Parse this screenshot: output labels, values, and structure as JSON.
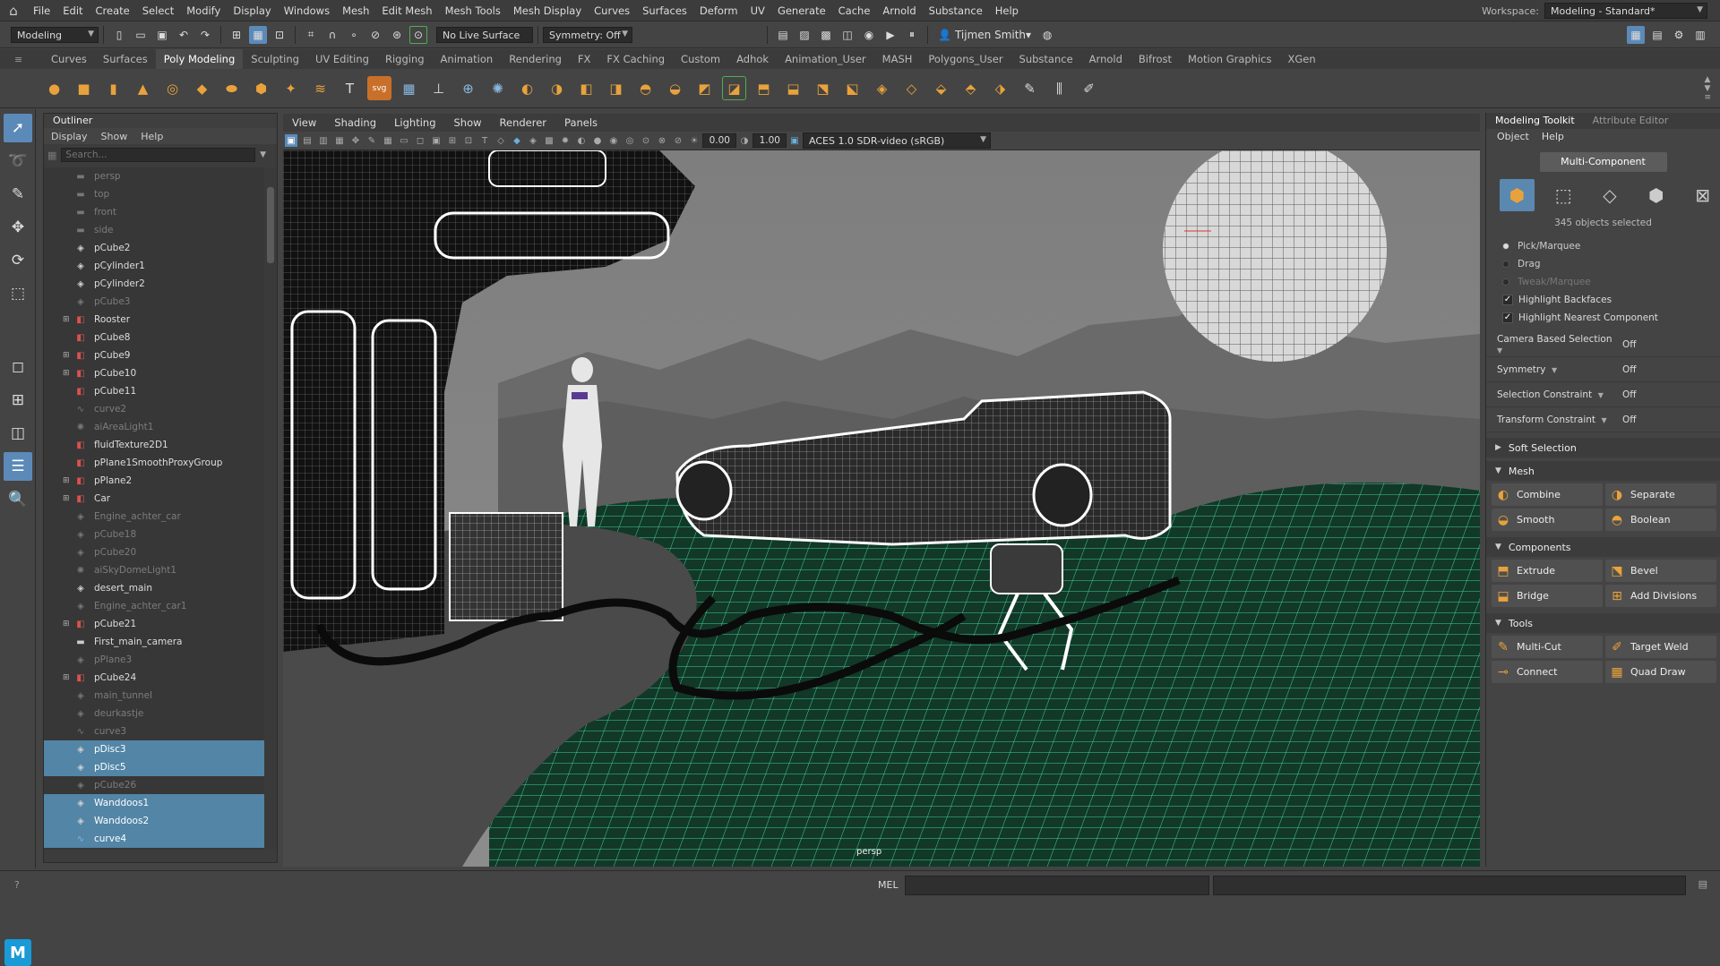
{
  "menubar": {
    "items": [
      "File",
      "Edit",
      "Create",
      "Select",
      "Modify",
      "Display",
      "Windows",
      "Mesh",
      "Edit Mesh",
      "Mesh Tools",
      "Mesh Display",
      "Curves",
      "Surfaces",
      "Deform",
      "UV",
      "Generate",
      "Cache",
      "Arnold",
      "Substance",
      "Help"
    ],
    "workspace_label": "Workspace:",
    "workspace_value": "Modeling - Standard*"
  },
  "statusline": {
    "mode": "Modeling",
    "live_surface": "No Live Surface",
    "symmetry": "Symmetry: Off",
    "user": "Tijmen Smith"
  },
  "shelf": {
    "tabs": [
      "Curves",
      "Surfaces",
      "Poly Modeling",
      "Sculpting",
      "UV Editing",
      "Rigging",
      "Animation",
      "Rendering",
      "FX",
      "FX Caching",
      "Custom",
      "Adhok",
      "Animation_User",
      "MASH",
      "Polygons_User",
      "Substance",
      "Arnold",
      "Bifrost",
      "Motion Graphics",
      "XGen"
    ],
    "active_tab": "Poly Modeling"
  },
  "outliner": {
    "title": "Outliner",
    "menu": [
      "Display",
      "Show",
      "Help"
    ],
    "search_placeholder": "Search...",
    "items": [
      {
        "label": "persp",
        "icon": "camera-icon",
        "dim": true,
        "expand": false,
        "sel": false
      },
      {
        "label": "top",
        "icon": "camera-icon",
        "dim": true,
        "expand": false,
        "sel": false
      },
      {
        "label": "front",
        "icon": "camera-icon",
        "dim": true,
        "expand": false,
        "sel": false
      },
      {
        "label": "side",
        "icon": "camera-icon",
        "dim": true,
        "expand": false,
        "sel": false
      },
      {
        "label": "pCube2",
        "icon": "mesh-icon",
        "dim": false,
        "expand": false,
        "sel": false
      },
      {
        "label": "pCylinder1",
        "icon": "mesh-icon",
        "dim": false,
        "expand": false,
        "sel": false
      },
      {
        "label": "pCylinder2",
        "icon": "mesh-icon",
        "dim": false,
        "expand": false,
        "sel": false
      },
      {
        "label": "pCube3",
        "icon": "mesh-icon",
        "dim": true,
        "expand": false,
        "sel": false
      },
      {
        "label": "Rooster",
        "icon": "group-icon",
        "dim": false,
        "expand": true,
        "sel": false
      },
      {
        "label": "pCube8",
        "icon": "group-icon",
        "dim": false,
        "expand": false,
        "sel": false
      },
      {
        "label": "pCube9",
        "icon": "group-icon",
        "dim": false,
        "expand": true,
        "sel": false
      },
      {
        "label": "pCube10",
        "icon": "group-icon",
        "dim": false,
        "expand": true,
        "sel": false
      },
      {
        "label": "pCube11",
        "icon": "group-icon",
        "dim": false,
        "expand": false,
        "sel": false
      },
      {
        "label": "curve2",
        "icon": "curve-icon",
        "dim": true,
        "expand": false,
        "sel": false
      },
      {
        "label": "aiAreaLight1",
        "icon": "light-icon",
        "dim": true,
        "expand": false,
        "sel": false
      },
      {
        "label": "fluidTexture2D1",
        "icon": "group-icon",
        "dim": false,
        "expand": false,
        "sel": false
      },
      {
        "label": "pPlane1SmoothProxyGroup",
        "icon": "group-icon",
        "dim": false,
        "expand": false,
        "sel": false
      },
      {
        "label": "pPlane2",
        "icon": "group-icon",
        "dim": false,
        "expand": true,
        "sel": false
      },
      {
        "label": "Car",
        "icon": "group-icon",
        "dim": false,
        "expand": true,
        "sel": false
      },
      {
        "label": "Engine_achter_car",
        "icon": "mesh-icon",
        "dim": true,
        "expand": false,
        "sel": false
      },
      {
        "label": "pCube18",
        "icon": "mesh-icon",
        "dim": true,
        "expand": false,
        "sel": false
      },
      {
        "label": "pCube20",
        "icon": "mesh-icon",
        "dim": true,
        "expand": false,
        "sel": false
      },
      {
        "label": "aiSkyDomeLight1",
        "icon": "light-icon",
        "dim": true,
        "expand": false,
        "sel": false
      },
      {
        "label": "desert_main",
        "icon": "mesh-icon",
        "dim": false,
        "expand": false,
        "sel": false
      },
      {
        "label": "Engine_achter_car1",
        "icon": "mesh-icon",
        "dim": true,
        "expand": false,
        "sel": false
      },
      {
        "label": "pCube21",
        "icon": "group-icon",
        "dim": false,
        "expand": true,
        "sel": false
      },
      {
        "label": "First_main_camera",
        "icon": "camera-icon",
        "dim": false,
        "expand": false,
        "sel": false
      },
      {
        "label": "pPlane3",
        "icon": "mesh-icon",
        "dim": true,
        "expand": false,
        "sel": false
      },
      {
        "label": "pCube24",
        "icon": "group-icon",
        "dim": false,
        "expand": true,
        "sel": false
      },
      {
        "label": "main_tunnel",
        "icon": "mesh-icon",
        "dim": true,
        "expand": false,
        "sel": false
      },
      {
        "label": "deurkastje",
        "icon": "mesh-icon",
        "dim": true,
        "expand": false,
        "sel": false
      },
      {
        "label": "curve3",
        "icon": "curve-icon",
        "dim": true,
        "expand": false,
        "sel": false
      },
      {
        "label": "pDisc3",
        "icon": "mesh-icon",
        "dim": false,
        "expand": false,
        "sel": true
      },
      {
        "label": "pDisc5",
        "icon": "mesh-icon",
        "dim": false,
        "expand": false,
        "sel": true
      },
      {
        "label": "pCube26",
        "icon": "mesh-icon",
        "dim": true,
        "expand": false,
        "sel": false
      },
      {
        "label": "Wanddoos1",
        "icon": "mesh-icon",
        "dim": false,
        "expand": false,
        "sel": true
      },
      {
        "label": "Wanddoos2",
        "icon": "mesh-icon",
        "dim": false,
        "expand": false,
        "sel": true
      },
      {
        "label": "curve4",
        "icon": "curve-icon",
        "dim": false,
        "expand": false,
        "sel": true
      }
    ]
  },
  "viewport": {
    "menu": [
      "View",
      "Shading",
      "Lighting",
      "Show",
      "Renderer",
      "Panels"
    ],
    "exposure": "0.00",
    "gamma": "1.00",
    "color_space": "ACES 1.0 SDR-video (sRGB)",
    "camera_label": "persp"
  },
  "toolkit": {
    "tabs": [
      "Modeling Toolkit",
      "Attribute Editor"
    ],
    "menu": [
      "Object",
      "Help"
    ],
    "mode_button": "Multi-Component",
    "selection_count": "345 objects selected",
    "pick_marquee": "Pick/Marquee",
    "drag": "Drag",
    "tweak_marquee": "Tweak/Marquee",
    "highlight_backfaces": "Highlight Backfaces",
    "highlight_nearest": "Highlight Nearest Component",
    "options": [
      {
        "label": "Camera Based Selection",
        "value": "Off"
      },
      {
        "label": "Symmetry",
        "value": "Off"
      },
      {
        "label": "Selection Constraint",
        "value": "Off"
      },
      {
        "label": "Transform Constraint",
        "value": "Off"
      }
    ],
    "soft_selection": "Soft Selection",
    "sections": [
      {
        "title": "Mesh",
        "buttons": [
          "Combine",
          "Separate",
          "Smooth",
          "Boolean"
        ]
      },
      {
        "title": "Components",
        "buttons": [
          "Extrude",
          "Bevel",
          "Bridge",
          "Add Divisions"
        ]
      },
      {
        "title": "Tools",
        "buttons": [
          "Multi-Cut",
          "Target Weld",
          "Connect",
          "Quad Draw"
        ]
      }
    ]
  },
  "commandline": {
    "label": "MEL"
  },
  "colors": {
    "accent": "#5285a6",
    "icon_orange": "#e9a23b",
    "wire_green": "#4be8a8"
  }
}
